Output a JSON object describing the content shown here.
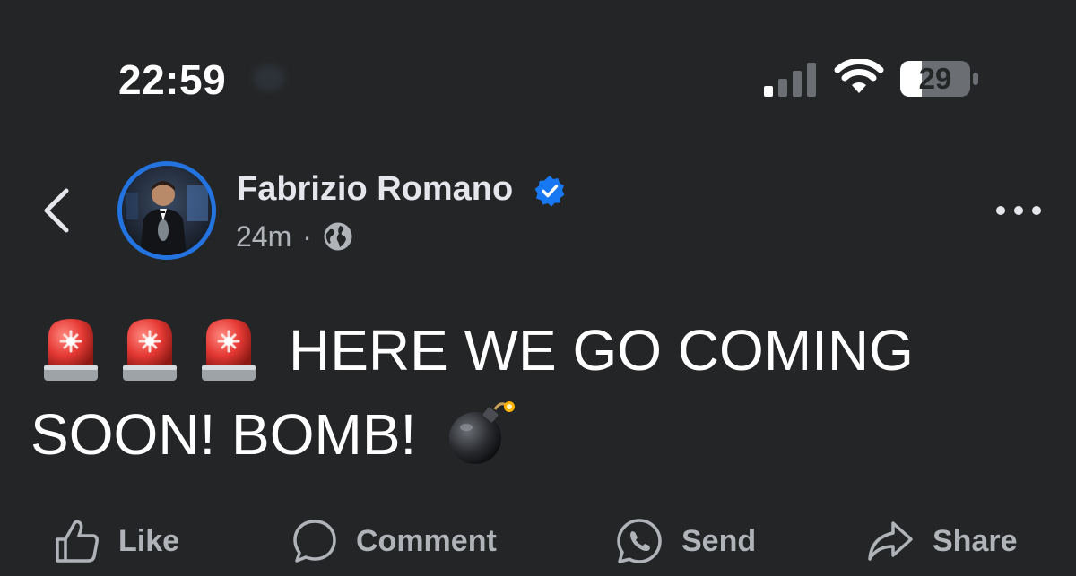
{
  "status_bar": {
    "time": "22:59",
    "battery_level": "29",
    "signal_icon": "cellular-signal-icon",
    "wifi_icon": "wifi-icon"
  },
  "post": {
    "author": "Fabrizio Romano",
    "verified": true,
    "timestamp": "24m",
    "separator": "·",
    "audience_icon": "globe-icon",
    "text_line1": "HERE WE GO COMING",
    "text_line2": "SOON! BOMB!",
    "emojis": [
      "rotating-light",
      "rotating-light",
      "rotating-light",
      "bomb"
    ]
  },
  "actions": {
    "like": "Like",
    "comment": "Comment",
    "send": "Send",
    "share": "Share"
  },
  "colors": {
    "background": "#242526",
    "text_primary": "#e4e6eb",
    "text_secondary": "#b0b3b8",
    "accent": "#2374e1",
    "verified": "#1877f2"
  }
}
